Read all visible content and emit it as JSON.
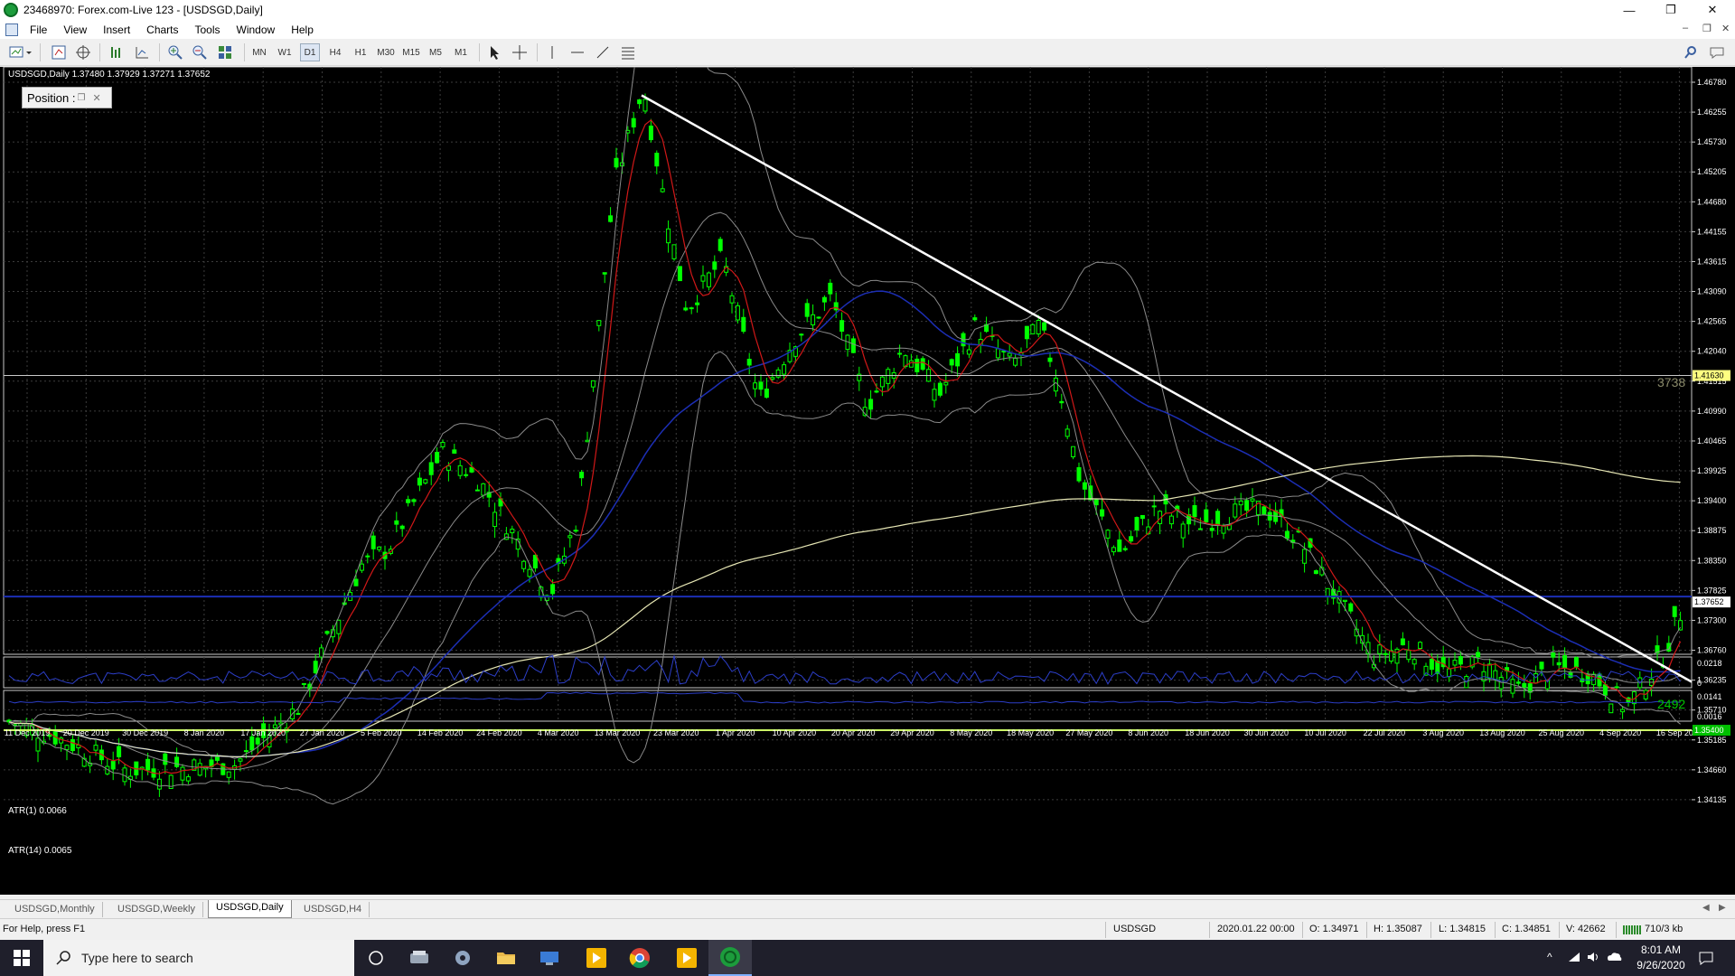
{
  "window": {
    "title": "23468970: Forex.com-Live 123 - [USDSGD,Daily]",
    "minimize": "—",
    "restore": "❐",
    "close": "✕"
  },
  "menu": [
    "File",
    "View",
    "Insert",
    "Charts",
    "Tools",
    "Window",
    "Help"
  ],
  "toolbar": {
    "timeframes": [
      "MN",
      "W1",
      "D1",
      "H4",
      "H1",
      "M30",
      "M15",
      "M5",
      "M1"
    ]
  },
  "chart": {
    "info": "USDSGD,Daily  1.37480 1.37929 1.37271 1.37652",
    "position_panel": "Position : ",
    "price_labels": [
      "1.46780",
      "1.46255",
      "1.45730",
      "1.45205",
      "1.44680",
      "1.44155",
      "1.43615",
      "1.43090",
      "1.42565",
      "1.42040",
      "1.41515",
      "1.40990",
      "1.40465",
      "1.39925",
      "1.39400",
      "1.38875",
      "1.38350",
      "1.37825",
      "1.37300",
      "1.36760",
      "1.36235",
      "1.35710",
      "1.35185",
      "1.34660",
      "1.34135"
    ],
    "level_tags": {
      "upper": "1.41630",
      "current": "1.37652",
      "lower": "1.35400"
    },
    "overlay_numbers": {
      "upper": "3738",
      "lower": "2492"
    },
    "atr1": {
      "label": "ATR(1) 0.0066",
      "scale": [
        "0.0218",
        "0"
      ]
    },
    "atr14": {
      "label": "ATR(14) 0.0065",
      "scale": [
        "0.0141",
        "0.0016"
      ]
    },
    "date_labels": [
      "11 Dec 2019",
      "20 Dec 2019",
      "30 Dec 2019",
      "8 Jan 2020",
      "17 Jan 2020",
      "27 Jan 2020",
      "5 Feb 2020",
      "14 Feb 2020",
      "24 Feb 2020",
      "4 Mar 2020",
      "13 Mar 2020",
      "23 Mar 2020",
      "1 Apr 2020",
      "10 Apr 2020",
      "20 Apr 2020",
      "29 Apr 2020",
      "8 May 2020",
      "18 May 2020",
      "27 May 2020",
      "8 Jun 2020",
      "18 Jun 2020",
      "30 Jun 2020",
      "10 Jul 2020",
      "22 Jul 2020",
      "3 Aug 2020",
      "13 Aug 2020",
      "25 Aug 2020",
      "4 Sep 2020",
      "16 Sep 2020"
    ]
  },
  "tabs": [
    "USDSGD,Monthly",
    "USDSGD,Weekly",
    "USDSGD,Daily",
    "USDSGD,H4"
  ],
  "status": {
    "help": "For Help, press F1",
    "symbol": "USDSGD",
    "datetime": "2020.01.22 00:00",
    "open": "O: 1.34971",
    "high": "H: 1.35087",
    "low": "L: 1.34815",
    "close": "C: 1.34851",
    "volume": "V: 42662",
    "traffic": "710/3 kb"
  },
  "taskbar": {
    "search_placeholder": "Type here to search",
    "time": "8:01 AM",
    "date": "9/26/2020"
  },
  "colors": {
    "grid": "#3c3c3c",
    "bull_candle": "#00ff00",
    "trendline": "#ffffff",
    "blue_ma": "#1c2eb4",
    "red_ma": "#d01818",
    "beige_ma": "#e6e6b4",
    "level_line": "#ccff66"
  }
}
